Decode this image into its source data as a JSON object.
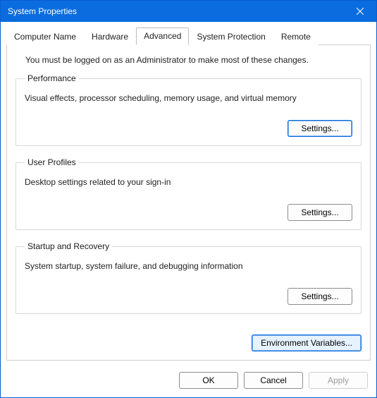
{
  "window": {
    "title": "System Properties"
  },
  "tabs": [
    {
      "label": "Computer Name"
    },
    {
      "label": "Hardware"
    },
    {
      "label": "Advanced"
    },
    {
      "label": "System Protection"
    },
    {
      "label": "Remote"
    }
  ],
  "admin_note": "You must be logged on as an Administrator to make most of these changes.",
  "groups": {
    "performance": {
      "legend": "Performance",
      "desc": "Visual effects, processor scheduling, memory usage, and virtual memory",
      "button": "Settings..."
    },
    "user_profiles": {
      "legend": "User Profiles",
      "desc": "Desktop settings related to your sign-in",
      "button": "Settings..."
    },
    "startup": {
      "legend": "Startup and Recovery",
      "desc": "System startup, system failure, and debugging information",
      "button": "Settings..."
    }
  },
  "env_button": "Environment Variables...",
  "dialog": {
    "ok": "OK",
    "cancel": "Cancel",
    "apply": "Apply"
  }
}
